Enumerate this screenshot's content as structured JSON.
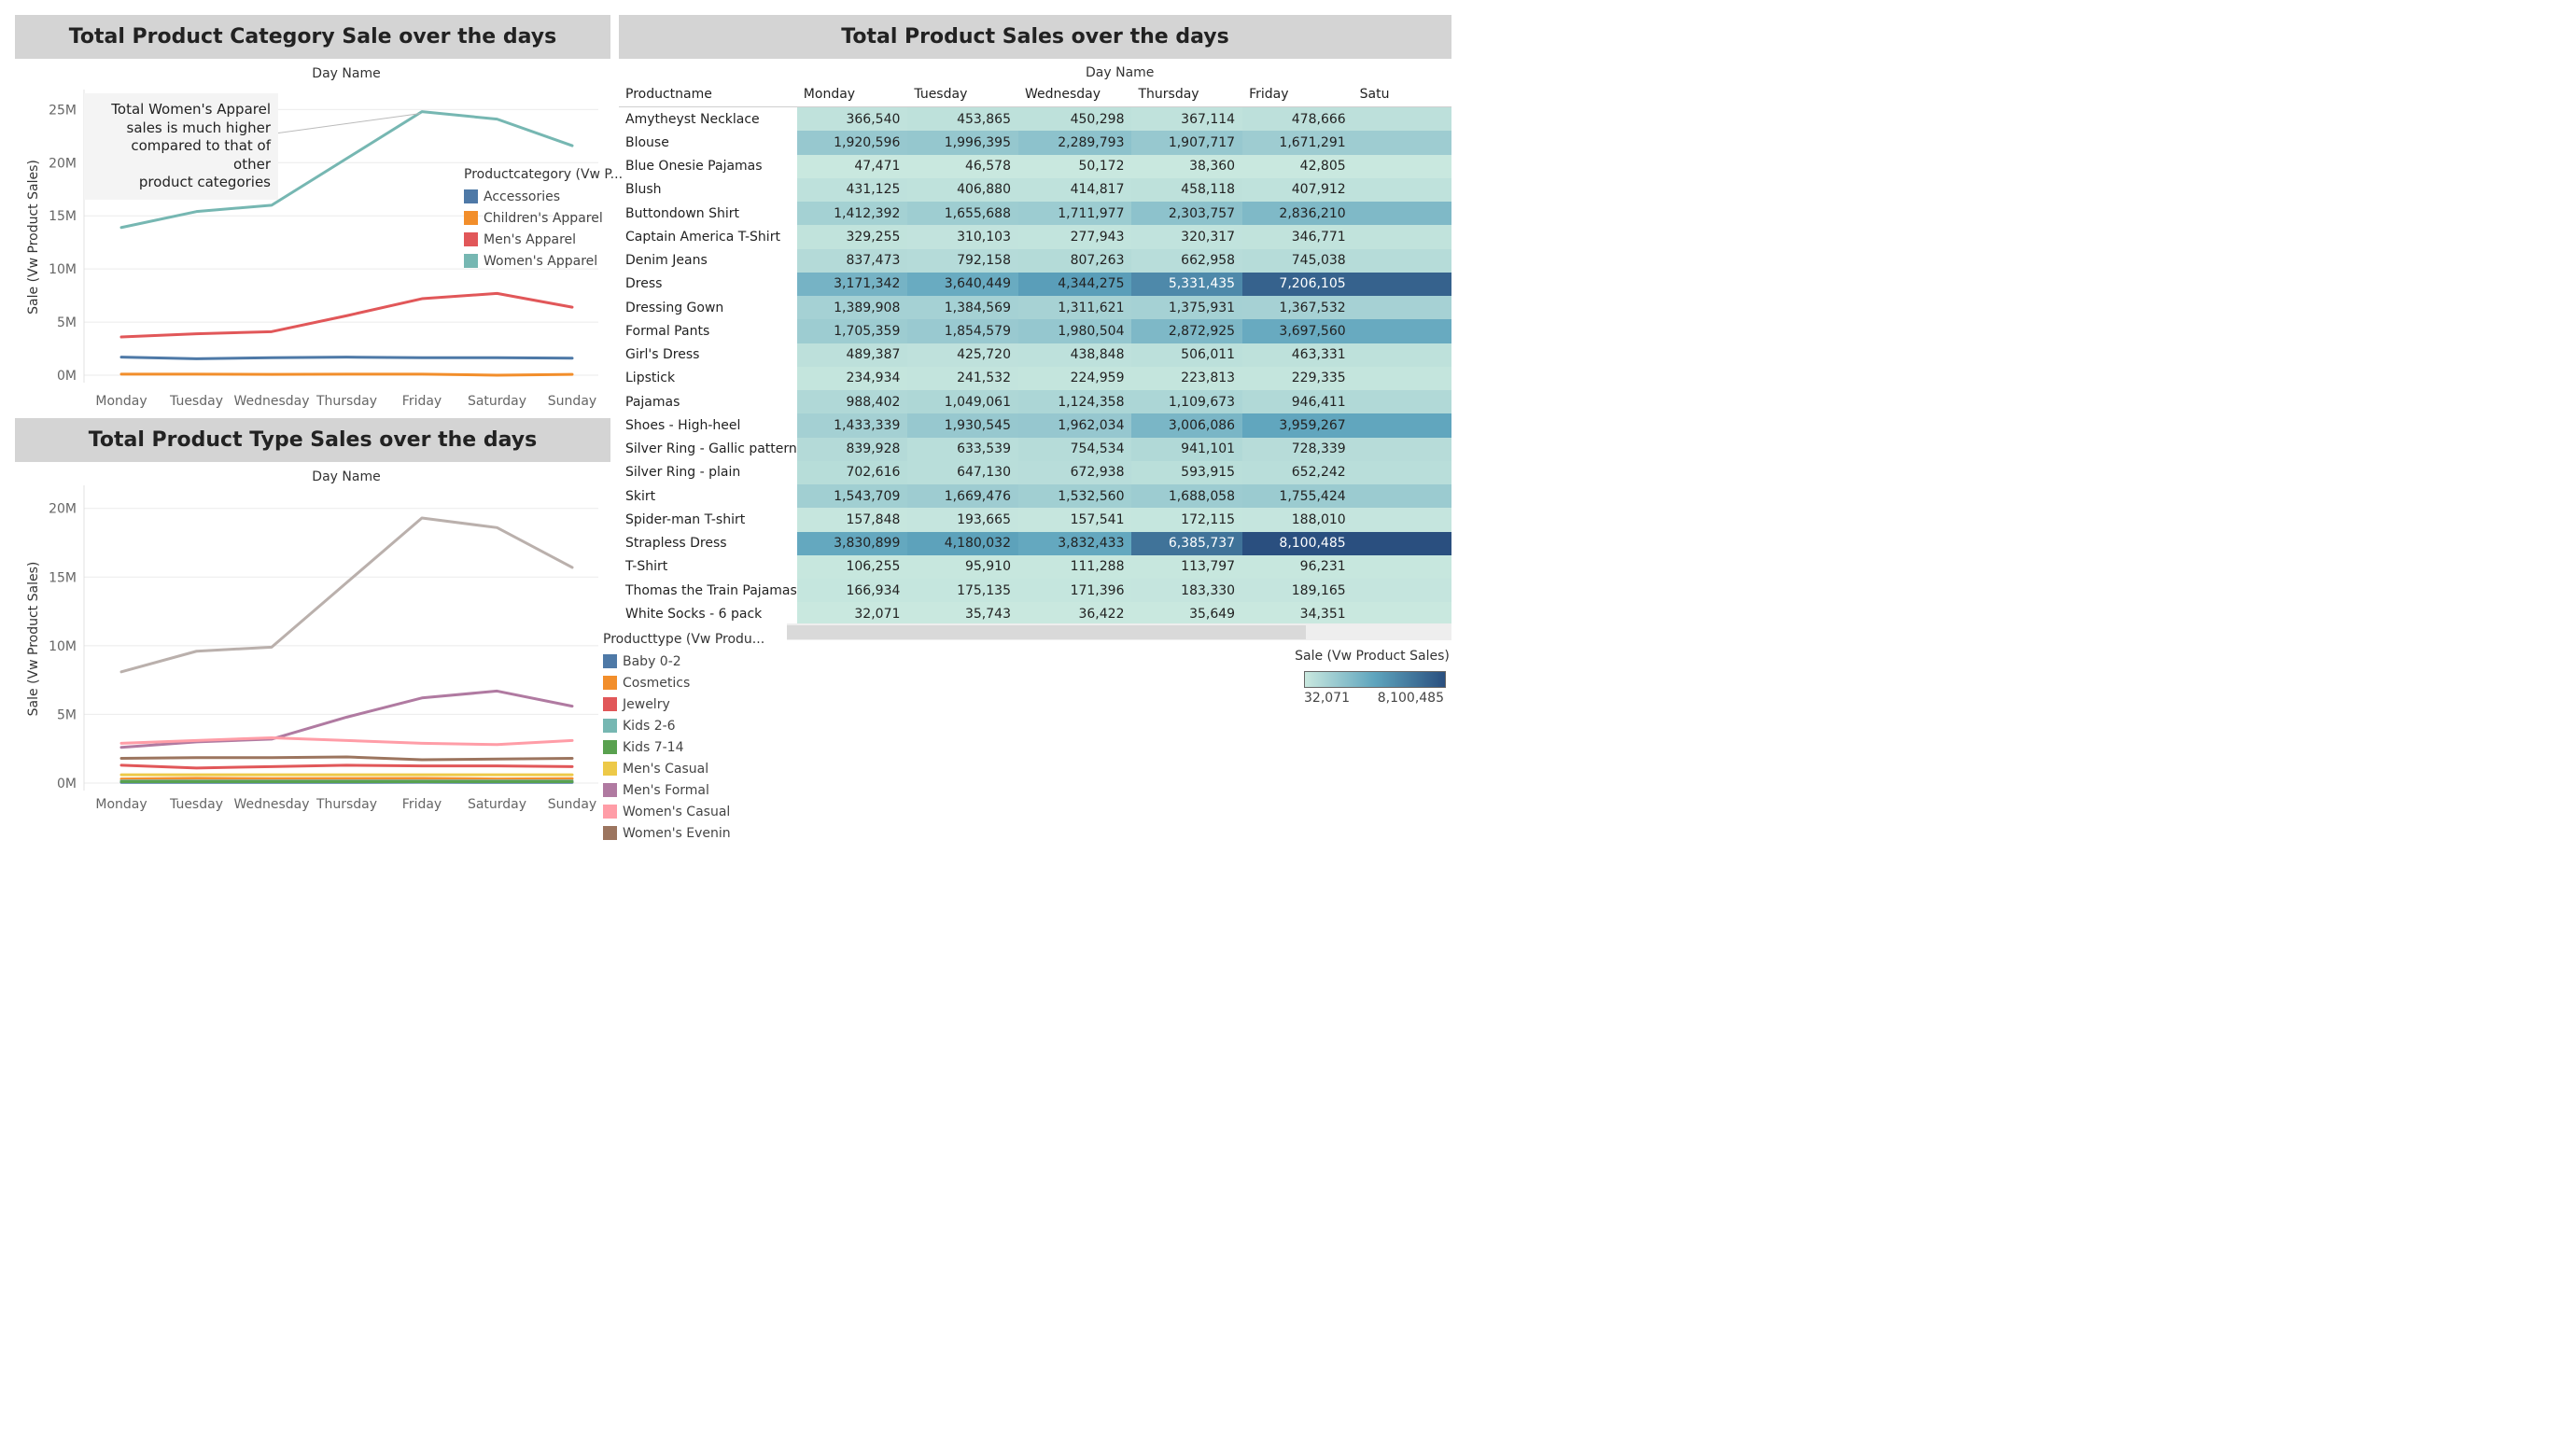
{
  "titles": {
    "category": "Total Product Category Sale over the days",
    "product": "Total Product Sales over the days",
    "type": "Total Product Type Sales over the days"
  },
  "annotation": {
    "lines": [
      "Total Women's Apparel",
      "sales is much higher",
      "compared to that of other",
      "product categories"
    ]
  },
  "colors": {
    "title_bar": "#d4d4d4",
    "heat_low": "#c9e8df",
    "heat_mid": "#5ea4bd",
    "heat_high": "#2a4f7f"
  },
  "chart_data": [
    {
      "id": "category",
      "type": "line",
      "xlabel": "Day Name",
      "ylabel": "Sale (Vw Product Sales)",
      "categories": [
        "Monday",
        "Tuesday",
        "Wednesday",
        "Thursday",
        "Friday",
        "Saturday",
        "Sunday"
      ],
      "ylim": [
        0,
        26000000
      ],
      "yticks": [
        0,
        5000000,
        10000000,
        15000000,
        20000000,
        25000000
      ],
      "ytick_labels": [
        "0M",
        "5M",
        "10M",
        "15M",
        "20M",
        "25M"
      ],
      "grid": true,
      "legend_title": "Productcategory (Vw P...",
      "series": [
        {
          "name": "Accessories",
          "color": "#4e79a7",
          "values": [
            1700000,
            1550000,
            1650000,
            1700000,
            1650000,
            1650000,
            1600000
          ]
        },
        {
          "name": "Children's Apparel",
          "color": "#f28e2b",
          "values": [
            100000,
            100000,
            80000,
            100000,
            100000,
            0,
            80000
          ]
        },
        {
          "name": "Men's Apparel",
          "color": "#e15759",
          "values": [
            3600000,
            3900000,
            4100000,
            5600000,
            7200000,
            7700000,
            6400000
          ]
        },
        {
          "name": "Women's Apparel",
          "color": "#76b7b2",
          "values": [
            13900000,
            15400000,
            16000000,
            20400000,
            24800000,
            24100000,
            21600000
          ]
        }
      ]
    },
    {
      "id": "type",
      "type": "line",
      "xlabel": "Day Name",
      "ylabel": "Sale (Vw Product Sales)",
      "categories": [
        "Monday",
        "Tuesday",
        "Wednesday",
        "Thursday",
        "Friday",
        "Saturday",
        "Sunday"
      ],
      "ylim": [
        0,
        21000000
      ],
      "yticks": [
        0,
        5000000,
        10000000,
        15000000,
        20000000
      ],
      "ytick_labels": [
        "0M",
        "5M",
        "10M",
        "15M",
        "20M"
      ],
      "grid": true,
      "legend_title": "Producttype (Vw Produ...",
      "series": [
        {
          "name": "Baby 0-2",
          "color": "#4e79a7",
          "values": [
            50000,
            50000,
            50000,
            50000,
            60000,
            50000,
            50000
          ]
        },
        {
          "name": "Cosmetics",
          "color": "#f28e2b",
          "values": [
            300000,
            350000,
            320000,
            330000,
            340000,
            300000,
            320000
          ]
        },
        {
          "name": "Jewelry",
          "color": "#e15759",
          "values": [
            1300000,
            1100000,
            1200000,
            1300000,
            1250000,
            1250000,
            1200000
          ]
        },
        {
          "name": "Kids 2-6",
          "color": "#76b7b2",
          "values": [
            150000,
            150000,
            150000,
            150000,
            150000,
            150000,
            150000
          ]
        },
        {
          "name": "Kids 7-14",
          "color": "#59a14f",
          "values": [
            100000,
            100000,
            100000,
            100000,
            100000,
            100000,
            100000
          ]
        },
        {
          "name": "Men's Casual",
          "color": "#edc948",
          "values": [
            600000,
            600000,
            600000,
            600000,
            600000,
            600000,
            600000
          ]
        },
        {
          "name": "Men's Formal",
          "color": "#b07aa1",
          "values": [
            2600000,
            3000000,
            3200000,
            4800000,
            6200000,
            6700000,
            5600000
          ]
        },
        {
          "name": "Women's Casual",
          "color": "#ff9da7",
          "values": [
            2900000,
            3100000,
            3300000,
            3100000,
            2900000,
            2800000,
            3100000
          ]
        },
        {
          "name": "Women's Evenin",
          "color": "#9c755f",
          "values": [
            1800000,
            1850000,
            1850000,
            1900000,
            1700000,
            1750000,
            1800000
          ]
        },
        {
          "name": "",
          "color": "#bab0ac",
          "values": [
            8100000,
            9600000,
            9900000,
            14600000,
            19300000,
            18600000,
            15700000
          ]
        }
      ]
    },
    {
      "id": "product",
      "type": "heatmap",
      "column_group_label": "Day Name",
      "row_header": "Productname",
      "columns": [
        "Monday",
        "Tuesday",
        "Wednesday",
        "Thursday",
        "Friday",
        "Satu"
      ],
      "color_legend": {
        "title": "Sale (Vw Product Sales)",
        "min_label": "32,071",
        "max_label": "8,100,485",
        "min": 32071,
        "max": 8100485
      },
      "rows": [
        {
          "name": "Amytheyst Necklace",
          "values": [
            366540,
            453865,
            450298,
            367114,
            478666
          ]
        },
        {
          "name": "Blouse",
          "values": [
            1920596,
            1996395,
            2289793,
            1907717,
            1671291
          ]
        },
        {
          "name": "Blue Onesie Pajamas",
          "values": [
            47471,
            46578,
            50172,
            38360,
            42805
          ]
        },
        {
          "name": "Blush",
          "values": [
            431125,
            406880,
            414817,
            458118,
            407912
          ]
        },
        {
          "name": "Buttondown Shirt",
          "values": [
            1412392,
            1655688,
            1711977,
            2303757,
            2836210
          ]
        },
        {
          "name": "Captain America T-Shirt",
          "values": [
            329255,
            310103,
            277943,
            320317,
            346771
          ]
        },
        {
          "name": "Denim Jeans",
          "values": [
            837473,
            792158,
            807263,
            662958,
            745038
          ]
        },
        {
          "name": "Dress",
          "values": [
            3171342,
            3640449,
            4344275,
            5331435,
            7206105
          ]
        },
        {
          "name": "Dressing Gown",
          "values": [
            1389908,
            1384569,
            1311621,
            1375931,
            1367532
          ]
        },
        {
          "name": "Formal Pants",
          "values": [
            1705359,
            1854579,
            1980504,
            2872925,
            3697560
          ]
        },
        {
          "name": "Girl's Dress",
          "values": [
            489387,
            425720,
            438848,
            506011,
            463331
          ]
        },
        {
          "name": "Lipstick",
          "values": [
            234934,
            241532,
            224959,
            223813,
            229335
          ]
        },
        {
          "name": "Pajamas",
          "values": [
            988402,
            1049061,
            1124358,
            1109673,
            946411
          ]
        },
        {
          "name": "Shoes - High-heel",
          "values": [
            1433339,
            1930545,
            1962034,
            3006086,
            3959267
          ]
        },
        {
          "name": "Silver Ring - Gallic pattern",
          "values": [
            839928,
            633539,
            754534,
            941101,
            728339
          ]
        },
        {
          "name": "Silver Ring - plain",
          "values": [
            702616,
            647130,
            672938,
            593915,
            652242
          ]
        },
        {
          "name": "Skirt",
          "values": [
            1543709,
            1669476,
            1532560,
            1688058,
            1755424
          ]
        },
        {
          "name": "Spider-man T-shirt",
          "values": [
            157848,
            193665,
            157541,
            172115,
            188010
          ]
        },
        {
          "name": "Strapless Dress",
          "values": [
            3830899,
            4180032,
            3832433,
            6385737,
            8100485
          ]
        },
        {
          "name": "T-Shirt",
          "values": [
            106255,
            95910,
            111288,
            113797,
            96231
          ]
        },
        {
          "name": "Thomas the Train Pajamas",
          "values": [
            166934,
            175135,
            171396,
            183330,
            189165
          ]
        },
        {
          "name": "White Socks - 6 pack",
          "values": [
            32071,
            35743,
            36422,
            35649,
            34351
          ]
        }
      ],
      "partial_column_values": [
        478666,
        1671291,
        42805,
        407912,
        2836210,
        346771,
        745038,
        7206105,
        1367532,
        3697560,
        463331,
        229335,
        946411,
        3959267,
        728339,
        652242,
        1755424,
        188010,
        8100485,
        96231,
        189165,
        34351
      ]
    }
  ]
}
